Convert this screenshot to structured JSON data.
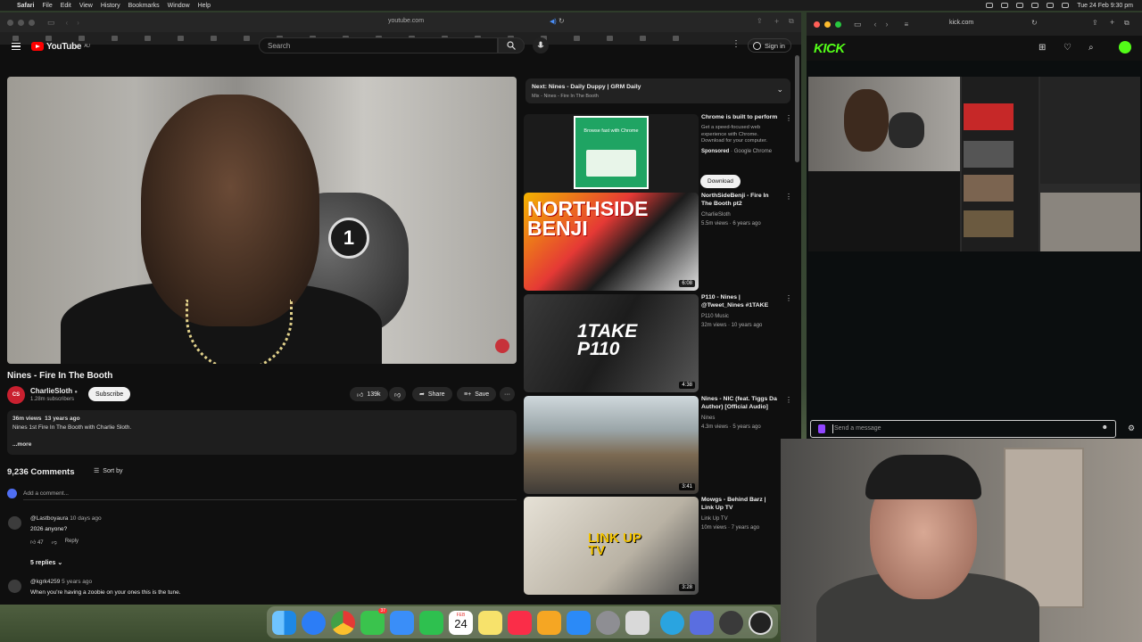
{
  "menubar": {
    "app": "Safari",
    "items": [
      "File",
      "Edit",
      "View",
      "History",
      "Bookmarks",
      "Window",
      "Help"
    ],
    "clock": "Tue 24 Feb 9:30 pm"
  },
  "safari": {
    "url": "youtube.com"
  },
  "youtube": {
    "logo_text": "YouTube",
    "logo_region": "AU",
    "search_placeholder": "Search",
    "signin_label": "Sign in",
    "video": {
      "title": "Nines - Fire In The Booth",
      "channel": "CharlieSloth",
      "subscribers": "1.28m subscribers",
      "subscribe_label": "Subscribe",
      "likes": "139k",
      "share_label": "Share",
      "save_label": "Save",
      "views": "36m views",
      "age": "13 years ago",
      "description": "Nines 1st Fire In The Booth with Charlie Sloth.",
      "more_label": "...more"
    },
    "comments": {
      "count_label": "9,236 Comments",
      "sort_label": "Sort by",
      "add_placeholder": "Add a comment...",
      "items": [
        {
          "user": "@Lastboyaura",
          "time": "10 days ago",
          "text": "2026 anyone?",
          "likes": "47",
          "reply_label": "Reply",
          "replies_label": "5 replies"
        },
        {
          "user": "@kgrk4259",
          "time": "5 years ago",
          "text": "When you're having a zoobie on your ones this is the tune."
        }
      ]
    },
    "next": {
      "title": "Next: Nines - Daily Duppy | GRM Daily",
      "sub": "Mix - Nines - Fire In The Booth"
    },
    "recommendations": [
      {
        "title": "Chrome is built to perform",
        "desc": "Get a speed-focused web experience with Chrome. Download for your computer.",
        "sponsor": "Sponsored",
        "advertiser": "Google Chrome",
        "button": "Download",
        "thumb_text": "Browse fast with Chrome"
      },
      {
        "title": "NorthSideBenji - Fire In The Booth pt2",
        "channel": "CharlieSloth",
        "meta": "5.5m views · 6 years ago",
        "duration": "6:08",
        "thumb_text": "NORTHSIDE BENJI"
      },
      {
        "title": "P110 - Nines | @Tweet_Nines #1TAKE",
        "channel": "P110 Music",
        "meta": "32m views · 10 years ago",
        "duration": "4:38",
        "thumb_text": "1TAKE P110"
      },
      {
        "title": "Nines - NIC (feat. Tiggs Da Author) [Official Audio]",
        "channel": "Nines",
        "meta": "4.3m views · 5 years ago",
        "duration": "3:41"
      },
      {
        "title": "Mowgs - Behind Barz | Link Up TV",
        "channel": "Link Up TV",
        "meta": "10m views · 7 years ago",
        "duration": "3:28",
        "thumb_text": "LINK UP TV"
      }
    ]
  },
  "kick": {
    "url": "kick.com",
    "logo": "KICK",
    "chat_placeholder": "Send a message"
  },
  "dock": {
    "calendar_month": "FEB",
    "calendar_day": "24",
    "messages_badge": "37",
    "apps": [
      "finder-icon",
      "safari-icon",
      "chrome-icon",
      "messages-icon",
      "mail-icon",
      "facetime-icon",
      "calendar-icon",
      "notes-icon",
      "music-icon",
      "pages-icon",
      "appstore-icon",
      "settings-icon",
      "ios-app-icon",
      "telegram-icon",
      "screenshot-icon",
      "quicktime-icon",
      "obs-icon"
    ],
    "colors": {
      "finder": "#1e88e5",
      "safari": "#2c7df6",
      "chrome": "#e53935",
      "messages": "#3ac34d",
      "mail": "#3a8ef8",
      "facetime": "#2ec04f",
      "calendar": "#ffffff",
      "notes": "#f7e26b",
      "music": "#fa2d48",
      "pages": "#f5a623",
      "appstore": "#2b8af7",
      "settings": "#8e8e93",
      "ios": "#d9d9d9",
      "telegram": "#2aa4e0",
      "screenshot": "#5a6ee0",
      "quicktime": "#3a3a3a",
      "obs": "#222222"
    }
  }
}
